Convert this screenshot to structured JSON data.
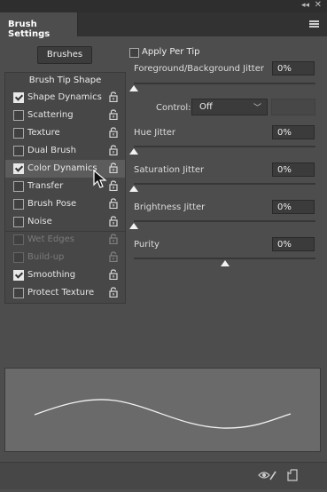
{
  "panel": {
    "title": "Brush Settings"
  },
  "window_controls": {
    "collapse": "◂◂",
    "close": "✕"
  },
  "left": {
    "brushes_button": "Brushes",
    "tip_shape": "Brush Tip Shape",
    "options": [
      {
        "label": "Shape Dynamics",
        "checked": true,
        "enabled": true
      },
      {
        "label": "Scattering",
        "checked": false,
        "enabled": true
      },
      {
        "label": "Texture",
        "checked": false,
        "enabled": true
      },
      {
        "label": "Dual Brush",
        "checked": false,
        "enabled": true
      },
      {
        "label": "Color Dynamics",
        "checked": true,
        "enabled": true,
        "selected": true
      },
      {
        "label": "Transfer",
        "checked": false,
        "enabled": true
      },
      {
        "label": "Brush Pose",
        "checked": false,
        "enabled": true
      },
      {
        "label": "Noise",
        "checked": false,
        "enabled": true
      },
      {
        "label": "Wet Edges",
        "checked": false,
        "enabled": false
      },
      {
        "label": "Build-up",
        "checked": false,
        "enabled": false
      },
      {
        "label": "Smoothing",
        "checked": true,
        "enabled": true
      },
      {
        "label": "Protect Texture",
        "checked": false,
        "enabled": true
      }
    ]
  },
  "right": {
    "apply_per_tip": {
      "label": "Apply Per Tip",
      "checked": false
    },
    "fg_bg_jitter": {
      "label": "Foreground/Background Jitter",
      "value": "0%",
      "level": 0
    },
    "control": {
      "label": "Control:",
      "value": "Off"
    },
    "hue_jitter": {
      "label": "Hue Jitter",
      "value": "0%",
      "level": 0
    },
    "saturation_jitter": {
      "label": "Saturation Jitter",
      "value": "0%",
      "level": 0
    },
    "brightness_jitter": {
      "label": "Brightness Jitter",
      "value": "0%",
      "level": 0
    },
    "purity": {
      "label": "Purity",
      "value": "0%",
      "level": 0.5
    }
  },
  "icons": {
    "panel_menu": "hamburger-menu-icon",
    "lock": "lock-icon",
    "toggle_preview": "eye-brush-icon",
    "new_preset": "new-preset-icon",
    "cursor": "mouse-pointer-icon"
  },
  "colors": {
    "panel_bg": "#4d4d4d",
    "field_bg": "#3b3b3b",
    "preview_bg": "#6a6a6a"
  }
}
